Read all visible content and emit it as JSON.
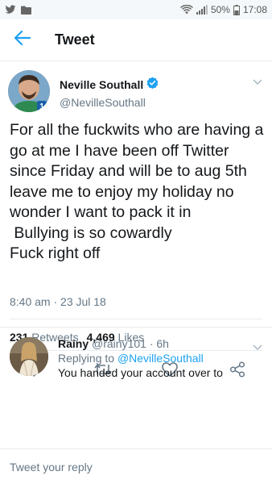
{
  "status_bar": {
    "battery_percent": "50%",
    "time": "17:08",
    "signal_icon": "signal-icon",
    "wifi_icon": "wifi-icon",
    "battery_icon": "battery-icon",
    "twitter_icon": "twitter-bird-icon",
    "folder_icon": "folder-icon"
  },
  "app_bar": {
    "title": "Tweet",
    "back_icon": "back-arrow-icon"
  },
  "tweet": {
    "author_name": "Neville Southall",
    "author_handle": "@NevilleSouthall",
    "verified_icon": "verified-badge-icon",
    "text": "For all the fuckwits who are having a go at me I have been off Twitter since Friday and will be to aug 5th leave me to enjoy my holiday no wonder I want to pack it in\n Bullying is so cowardly\nFuck right off",
    "timestamp": "8:40 am · 23 Jul 18",
    "retweets_count": "231",
    "retweets_label": "Retweets",
    "likes_count": "4,469",
    "likes_label": "Likes"
  },
  "actions": {
    "reply_icon": "reply-icon",
    "retweet_icon": "retweet-icon",
    "like_icon": "heart-icon",
    "share_icon": "share-icon"
  },
  "reply": {
    "name": "Rainy",
    "handle": "@rainy101",
    "age": "6h",
    "replying_prefix": "Replying to",
    "replying_handle": "@NevilleSouthall",
    "text": "You handed your account over to"
  },
  "composer": {
    "placeholder": "Tweet your reply"
  },
  "colors": {
    "accent": "#1da1f2",
    "text": "#14171a",
    "secondary_text": "#657786",
    "divider": "#e6ecf0"
  }
}
